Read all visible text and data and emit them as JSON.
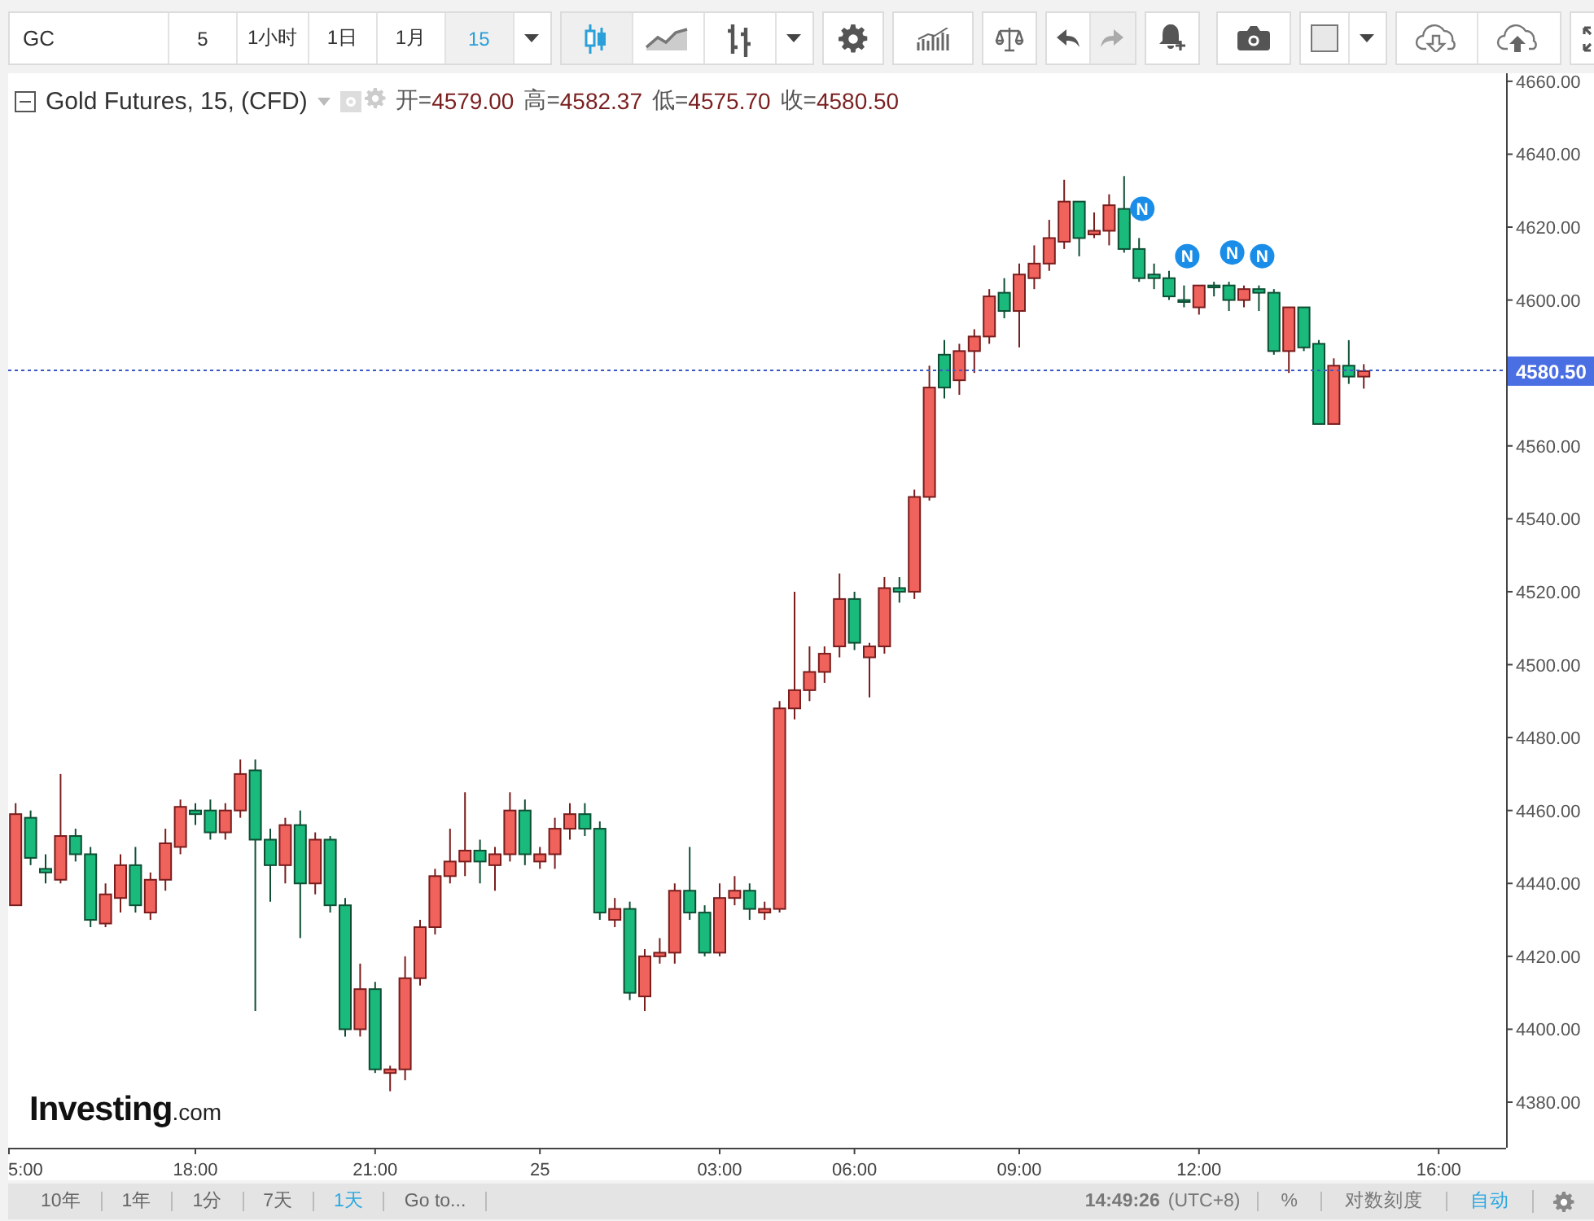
{
  "toolbar": {
    "symbol": "GC",
    "intervals": [
      {
        "label": "5",
        "selected": false
      },
      {
        "label": "1小时",
        "selected": false
      },
      {
        "label": "1日",
        "selected": false
      },
      {
        "label": "1月",
        "selected": false
      },
      {
        "label": "15",
        "selected": true
      }
    ],
    "chart_types": [
      {
        "kind": "candles",
        "selected": true
      },
      {
        "kind": "line",
        "selected": false
      },
      {
        "kind": "bars",
        "selected": false
      }
    ],
    "history": [
      {
        "kind": "undo",
        "disabled": false
      },
      {
        "kind": "redo",
        "disabled": true
      }
    ]
  },
  "legend": {
    "title": "Gold Futures, 15, (CFD)",
    "values": [
      {
        "label": "开=",
        "value": "4579.00"
      },
      {
        "label": "高=",
        "value": "4582.37"
      },
      {
        "label": "低=",
        "value": "4575.70"
      },
      {
        "label": "收=",
        "value": "4580.50"
      }
    ]
  },
  "chart": {
    "price_label": "4580.50",
    "logo": {
      "name": "Investing",
      "suffix": ".com"
    },
    "news_markers": [
      {
        "label": "N"
      },
      {
        "label": "N"
      },
      {
        "label": "N"
      },
      {
        "label": "N"
      }
    ],
    "chart_data": {
      "type": "candlestick",
      "categories": [
        "5:00",
        null,
        null,
        null,
        null,
        null,
        null,
        null,
        null,
        null,
        null,
        null,
        "18:00",
        null,
        null,
        null,
        null,
        null,
        null,
        null,
        null,
        null,
        null,
        null,
        "21:00",
        null,
        null,
        null,
        null,
        null,
        null,
        null,
        null,
        null,
        null,
        "25",
        null,
        null,
        null,
        null,
        null,
        null,
        null,
        null,
        null,
        null,
        null,
        "03:00",
        null,
        null,
        null,
        null,
        null,
        null,
        null,
        null,
        "06:00",
        null,
        null,
        null,
        null,
        null,
        null,
        null,
        null,
        null,
        null,
        "09:00",
        null,
        null,
        null,
        null,
        null,
        null,
        null,
        null,
        null,
        null,
        null,
        "12:00",
        null,
        null,
        null,
        null,
        null,
        null,
        null,
        null,
        null,
        null,
        null,
        null,
        null,
        null,
        null,
        "16:00",
        null,
        null,
        null,
        null
      ],
      "ylim": [
        4367.5,
        4662.2
      ],
      "yticks": [
        {
          "value": 4380,
          "label": "4380.00"
        },
        {
          "value": 4400,
          "label": "4400.00"
        },
        {
          "value": 4420,
          "label": "4420.00"
        },
        {
          "value": 4440,
          "label": "4440.00"
        },
        {
          "value": 4460,
          "label": "4460.00"
        },
        {
          "value": 4480,
          "label": "4480.00"
        },
        {
          "value": 4500,
          "label": "4500.00"
        },
        {
          "value": 4520,
          "label": "4520.00"
        },
        {
          "value": 4540,
          "label": "4540.00"
        },
        {
          "value": 4560,
          "label": "4560.00"
        },
        {
          "value": 4600,
          "label": "4600.00"
        },
        {
          "value": 4620,
          "label": "4620.00"
        },
        {
          "value": 4640,
          "label": "4640.00"
        },
        {
          "value": 4660,
          "label": "4660.00"
        }
      ],
      "ohlc": [
        [
          4434,
          4462,
          4434,
          4459
        ],
        [
          4458,
          4460,
          4445,
          4447
        ],
        [
          4444,
          4448,
          4440,
          4443
        ],
        [
          4441,
          4470,
          4440,
          4453
        ],
        [
          4453,
          4455,
          4446,
          4448
        ],
        [
          4448,
          4450,
          4428,
          4430
        ],
        [
          4429,
          4440,
          4428,
          4437
        ],
        [
          4436,
          4448,
          4432,
          4445
        ],
        [
          4445,
          4450,
          4432,
          4434
        ],
        [
          4432,
          4443,
          4430,
          4441
        ],
        [
          4441,
          4455,
          4438,
          4451
        ],
        [
          4450,
          4463,
          4448,
          4461
        ],
        [
          4460,
          4462,
          4456,
          4459
        ],
        [
          4460,
          4463,
          4452,
          4454
        ],
        [
          4454,
          4462,
          4452,
          4460
        ],
        [
          4460,
          4474,
          4458,
          4470
        ],
        [
          4471,
          4474,
          4405,
          4452
        ],
        [
          4452,
          4455,
          4435,
          4445
        ],
        [
          4445,
          4458,
          4440,
          4456
        ],
        [
          4456,
          4460,
          4425,
          4440
        ],
        [
          4440,
          4454,
          4437,
          4452
        ],
        [
          4452,
          4453,
          4432,
          4434
        ],
        [
          4434,
          4436,
          4398,
          4400
        ],
        [
          4400,
          4418,
          4398,
          4411
        ],
        [
          4411,
          4413,
          4388,
          4389
        ],
        [
          4388,
          4390,
          4383,
          4389
        ],
        [
          4389,
          4420,
          4386,
          4414
        ],
        [
          4414,
          4430,
          4412,
          4428
        ],
        [
          4428,
          4444,
          4426,
          4442
        ],
        [
          4442,
          4455,
          4440,
          4446
        ],
        [
          4446,
          4465,
          4442,
          4449
        ],
        [
          4449,
          4452,
          4440,
          4446
        ],
        [
          4445,
          4450,
          4438,
          4448
        ],
        [
          4448,
          4465,
          4446,
          4460
        ],
        [
          4460,
          4463,
          4445,
          4448
        ],
        [
          4446,
          4450,
          4444,
          4448
        ],
        [
          4448,
          4458,
          4444,
          4455
        ],
        [
          4455,
          4462,
          4452,
          4459
        ],
        [
          4459,
          4462,
          4453,
          4455
        ],
        [
          4455,
          4457,
          4430,
          4432
        ],
        [
          4430,
          4436,
          4428,
          4433
        ],
        [
          4433,
          4435,
          4408,
          4410
        ],
        [
          4409,
          4422,
          4405,
          4420
        ],
        [
          4420,
          4425,
          4418,
          4421
        ],
        [
          4421,
          4440,
          4418,
          4438
        ],
        [
          4438,
          4450,
          4430,
          4432
        ],
        [
          4432,
          4434,
          4420,
          4421
        ],
        [
          4421,
          4440,
          4420,
          4436
        ],
        [
          4436,
          4442,
          4434,
          4438
        ],
        [
          4438,
          4440,
          4430,
          4433
        ],
        [
          4432,
          4435,
          4430,
          4433
        ],
        [
          4433,
          4490,
          4432,
          4488
        ],
        [
          4488,
          4520,
          4485,
          4493
        ],
        [
          4493,
          4505,
          4490,
          4498
        ],
        [
          4498,
          4505,
          4495,
          4503
        ],
        [
          4505,
          4525,
          4502,
          4518
        ],
        [
          4518,
          4520,
          4504,
          4506
        ],
        [
          4502,
          4506,
          4491,
          4505
        ],
        [
          4505,
          4524,
          4503,
          4521
        ],
        [
          4521,
          4524,
          4517,
          4520
        ],
        [
          4520,
          4548,
          4518,
          4546
        ],
        [
          4546,
          4582,
          4545,
          4576
        ],
        [
          4585,
          4589,
          4573,
          4576
        ],
        [
          4578,
          4588,
          4574,
          4586
        ],
        [
          4586,
          4592,
          4580,
          4590
        ],
        [
          4590,
          4603,
          4588,
          4601
        ],
        [
          4602,
          4606,
          4595,
          4597
        ],
        [
          4597,
          4610,
          4587,
          4607
        ],
        [
          4606,
          4615,
          4603,
          4610
        ],
        [
          4610,
          4622,
          4608,
          4617
        ],
        [
          4616,
          4633,
          4614,
          4627
        ],
        [
          4627,
          4627,
          4612,
          4617
        ],
        [
          4618,
          4624,
          4617,
          4619
        ],
        [
          4619,
          4629,
          4615,
          4626
        ],
        [
          4625,
          4634,
          4613,
          4614
        ],
        [
          4614,
          4617,
          4605,
          4606
        ],
        [
          4607,
          4610,
          4603,
          4606
        ],
        [
          4606,
          4608,
          4600,
          4601
        ],
        [
          4600,
          4604,
          4598,
          4599.5
        ],
        [
          4598,
          4604,
          4596,
          4604
        ],
        [
          4604,
          4605,
          4601,
          4603.5
        ],
        [
          4604,
          4605,
          4597,
          4600
        ],
        [
          4600,
          4604,
          4598,
          4603
        ],
        [
          4603,
          4604,
          4597,
          4602
        ],
        [
          4602,
          4603,
          4585,
          4586
        ],
        [
          4586,
          4598,
          4580,
          4598
        ],
        [
          4598,
          4598,
          4586,
          4587
        ],
        [
          4588,
          4589,
          4566,
          4566
        ],
        [
          4566,
          4584,
          4566,
          4582
        ],
        [
          4582,
          4589,
          4577,
          4579
        ],
        [
          4579,
          4582.4,
          4575.7,
          4580.5
        ],
        null,
        null,
        null,
        null,
        null,
        null,
        null,
        null,
        null
      ]
    }
  },
  "bottom_bar": {
    "ranges": [
      {
        "label": "10年",
        "selected": false
      },
      {
        "label": "1年",
        "selected": false
      },
      {
        "label": "1分",
        "selected": false
      },
      {
        "label": "7天",
        "selected": false
      },
      {
        "label": "1天",
        "selected": true
      },
      {
        "label": "Go to...",
        "selected": false
      }
    ],
    "time": "14:49:26",
    "timezone": "(UTC+8)",
    "options": [
      {
        "label": "%",
        "selected": false
      },
      {
        "label": "对数刻度",
        "selected": false
      },
      {
        "label": "自动",
        "selected": true
      }
    ]
  }
}
